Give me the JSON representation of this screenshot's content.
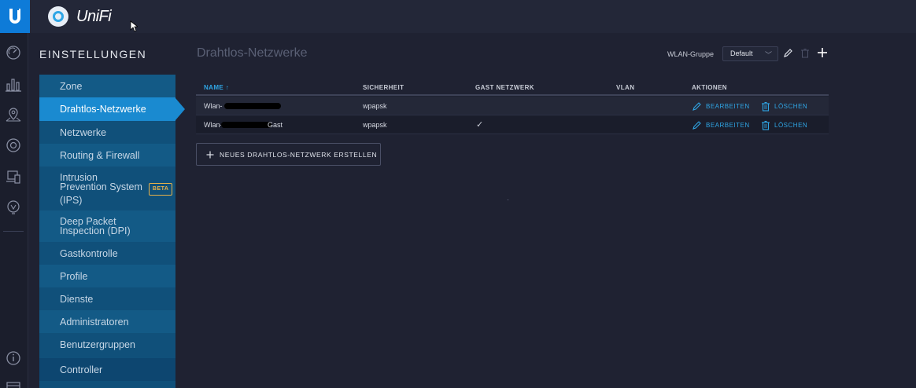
{
  "app": {
    "brand": "UniFi"
  },
  "sidebar": {
    "heading": "EINSTELLUNGEN",
    "items": [
      {
        "label": "Zone"
      },
      {
        "label": "Drahtlos-Netzwerke"
      },
      {
        "label": "Netzwerke"
      },
      {
        "label": "Routing & Firewall"
      },
      {
        "label": "Intrusion Prevention System (IPS)",
        "line1": "Intrusion",
        "line2": "Prevention System",
        "line3": "(IPS)",
        "badge": "BETA"
      },
      {
        "label": "Deep Packet Inspection (DPI)",
        "line1": "Deep Packet",
        "line2": "Inspection (DPI)"
      },
      {
        "label": "Gastkontrolle"
      },
      {
        "label": "Profile"
      },
      {
        "label": "Dienste"
      },
      {
        "label": "Administratoren"
      },
      {
        "label": "Benutzergruppen"
      },
      {
        "label": "Controller"
      }
    ]
  },
  "main": {
    "title": "Drahtlos-Netzwerke",
    "wlan_group_label": "WLAN-Gruppe",
    "wlan_group_value": "Default",
    "table": {
      "headers": {
        "name": "NAME ↑",
        "security": "SICHERHEIT",
        "guest": "GAST NETZWERK",
        "vlan": "VLAN",
        "actions": "AKTIONEN"
      },
      "rows": [
        {
          "name_prefix": "Wlan-",
          "name_suffix": "",
          "security": "wpapsk",
          "guest": "",
          "vlan": ""
        },
        {
          "name_prefix": "Wlan-",
          "name_suffix": "Gast",
          "security": "wpapsk",
          "guest": "✓",
          "vlan": ""
        }
      ],
      "edit_label": "BEARBEITEN",
      "delete_label": "LÖSCHEN"
    },
    "create_button": "NEUES DRAHTLOS-NETZWERK ERSTELLEN"
  },
  "colors": {
    "accent": "#2fa6e6",
    "menu_bg": "#10507a",
    "menu_active": "#1a8ad0",
    "brand_blue": "#0e7bd8"
  }
}
